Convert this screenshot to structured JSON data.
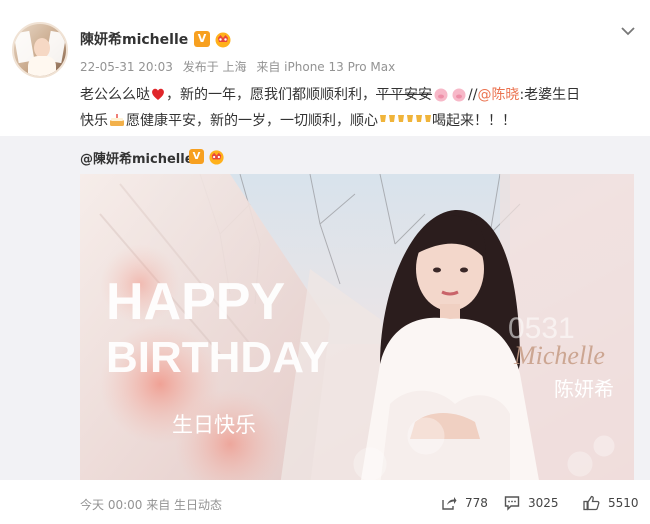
{
  "post": {
    "username": "陳妍希michelle",
    "verified_badge": "V",
    "member_icon": "member-crown-icon",
    "timestamp": "22-05-31 20:03",
    "published_in": "发布于 上海",
    "source": "来自 iPhone 13 Pro Max",
    "text": {
      "line1_part1": "老公么么哒",
      "line1_part2": "，新的一年，愿我们都顺顺利利，",
      "line1_strike": "平平安安",
      "line1_sep": "//",
      "mention": "@陈晓",
      "line1_part3": ":老婆生日",
      "line2_part1": "快乐",
      "line2_part2": "愿健康平安，新的一岁，一切顺利，顺心",
      "line2_part3": "喝起来！！！"
    },
    "emoji_names": [
      "red-heart-icon",
      "pig-face-icon",
      "birthday-cake-icon",
      "clinking-glasses-icon"
    ]
  },
  "repost": {
    "username": "@陳妍希michelle",
    "verified_badge": "V",
    "image": {
      "headline_line1": "HAPPY",
      "headline_line2": "BIRTHDAY",
      "chinese_greeting": "生日快乐",
      "signature": "Michelle",
      "name_cn": "陈妍希",
      "watermark": "0531"
    }
  },
  "footer": {
    "time": "今天 00:00",
    "source": "来自 生日动态",
    "share_count": "778",
    "comment_count": "3025",
    "like_count": "5510"
  },
  "colors": {
    "mention": "#eb7350",
    "meta_gray": "#939393",
    "repost_bg": "#f2f2f5",
    "badge_orange": "#f7a020"
  }
}
